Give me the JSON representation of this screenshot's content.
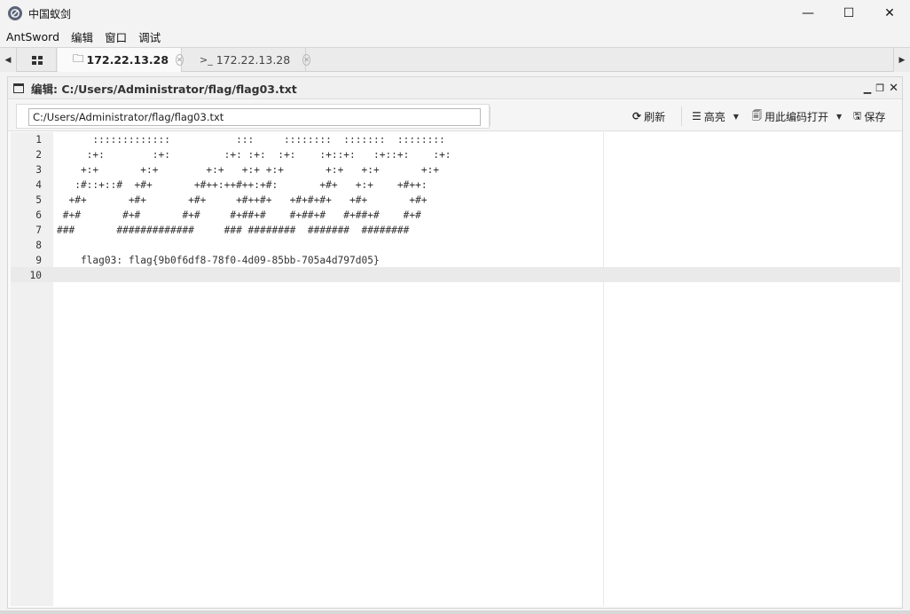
{
  "window": {
    "title": "中国蚁剑",
    "controls": {
      "minimize": "—",
      "maximize": "☐",
      "close": "✕"
    }
  },
  "menu": [
    "AntSword",
    "编辑",
    "窗口",
    "调试"
  ],
  "tabs": [
    {
      "label": "172.22.13.28",
      "icon": "folder-icon",
      "active": true
    },
    {
      "label": "172.22.13.28",
      "icon": "terminal-icon",
      "active": false
    }
  ],
  "panel": {
    "title": "编辑: C:/Users/Administrator/flag/flag03.txt",
    "path_value": "C:/Users/Administrator/flag/flag03.txt",
    "toolbar": {
      "refresh": "刷新",
      "highlight": "高亮",
      "open_encoding": "用此编码打开",
      "save": "保存"
    }
  },
  "editor": {
    "active_line": 10,
    "lines": [
      {
        "n": "1",
        "text": "      :::::::::::::           :::     ::::::::  :::::::  ::::::::"
      },
      {
        "n": "2",
        "text": "     :+:        :+:         :+: :+:  :+:    :+::+:   :+::+:    :+:"
      },
      {
        "n": "3",
        "text": "    +:+       +:+        +:+   +:+ +:+       +:+   +:+       +:+"
      },
      {
        "n": "4",
        "text": "   :#::+::#  +#+       +#++:++#++:+#:       +#+   +:+    +#++:"
      },
      {
        "n": "5",
        "text": "  +#+       +#+       +#+     +#++#+   +#+#+#+   +#+       +#+"
      },
      {
        "n": "6",
        "text": " #+#       #+#       #+#     #+##+#    #+##+#   #+##+#    #+#"
      },
      {
        "n": "7",
        "text": "###       #############     ### ########  #######  ########"
      },
      {
        "n": "8",
        "text": ""
      },
      {
        "n": "9",
        "text": "    flag03: flag{9b0f6df8-78f0-4d09-85bb-705a4d797d05}"
      },
      {
        "n": "10",
        "text": ""
      }
    ]
  }
}
